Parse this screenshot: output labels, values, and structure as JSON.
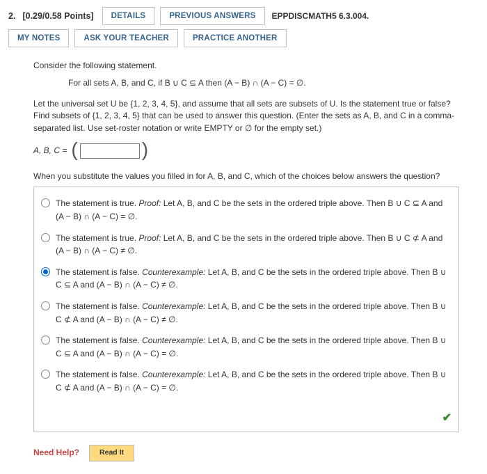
{
  "header": {
    "number": "2.",
    "points": "[0.29/0.58 Points]",
    "details": "DETAILS",
    "previous": "PREVIOUS ANSWERS",
    "ref": "EPPDISCMATH5 6.3.004.",
    "my_notes": "MY NOTES",
    "ask": "ASK YOUR TEACHER",
    "practice": "PRACTICE ANOTHER"
  },
  "body": {
    "consider": "Consider the following statement.",
    "statement": "For all sets A, B, and C, if B ∪ C ⊆ A then (A − B) ∩ (A − C) = ∅.",
    "para": "Let the universal set U be {1, 2, 3, 4, 5}, and assume that all sets are subsets of U. Is the statement true or false? Find subsets of {1, 2, 3, 4, 5} that can be used to answer this question. (Enter the sets as A, B, and C in a comma-separated list. Use set-roster notation or write EMPTY or ∅ for the empty set.)",
    "answer_label": "A, B, C =",
    "subst": "When you substitute the values you filled in for A, B, and C, which of the choices below answers the question?"
  },
  "choices": [
    {
      "prefix": "The statement is true. ",
      "em": "Proof:",
      "tail": " Let A, B, and C be the sets in the ordered triple above. Then B ∪ C ⊆ A and (A − B) ∩ (A − C) = ∅.",
      "selected": false
    },
    {
      "prefix": "The statement is true. ",
      "em": "Proof:",
      "tail": " Let A, B, and C be the sets in the ordered triple above. Then B ∪ C ⊄ A and (A − B) ∩ (A − C) ≠ ∅.",
      "selected": false
    },
    {
      "prefix": "The statement is false. ",
      "em": "Counterexample:",
      "tail": " Let A, B, and C be the sets in the ordered triple above. Then B ∪ C ⊆ A and (A − B) ∩ (A − C) ≠ ∅.",
      "selected": true
    },
    {
      "prefix": "The statement is false. ",
      "em": "Counterexample:",
      "tail": " Let A, B, and C be the sets in the ordered triple above. Then B ∪ C ⊄ A and (A − B) ∩ (A − C) ≠ ∅.",
      "selected": false
    },
    {
      "prefix": "The statement is false. ",
      "em": "Counterexample:",
      "tail": " Let A, B, and C be the sets in the ordered triple above. Then B ∪ C ⊆ A and (A − B) ∩ (A − C) = ∅.",
      "selected": false
    },
    {
      "prefix": "The statement is false. ",
      "em": "Counterexample:",
      "tail": " Let A, B, and C be the sets in the ordered triple above. Then B ∪ C ⊄ A and (A − B) ∩ (A − C) = ∅.",
      "selected": false
    }
  ],
  "footer": {
    "need_help": "Need Help?",
    "read_it": "Read It"
  }
}
